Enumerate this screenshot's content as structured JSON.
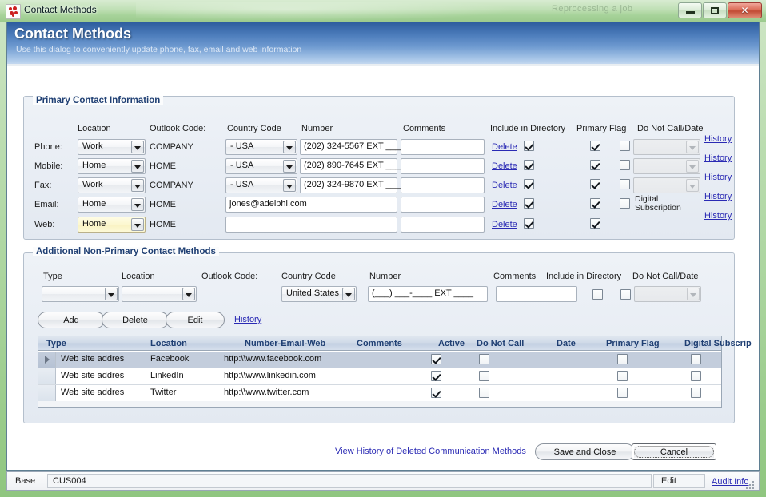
{
  "window": {
    "title": "Contact Methods",
    "icon": "balloons-icon",
    "ghost_text": "Reprocessing a job",
    "controls": {
      "minimize": "minimize-button",
      "maximize": "maximize-button",
      "close": "close-button"
    }
  },
  "banner": {
    "title": "Contact Methods",
    "subtitle": "Use this dialog to conveniently update phone, fax, email and web information"
  },
  "primary_group": {
    "title": "Primary Contact Information",
    "headers": {
      "location": "Location",
      "outlook_code": "Outlook Code:",
      "country_code": "Country Code",
      "number": "Number",
      "comments": "Comments",
      "include_in_directory": "Include in Directory",
      "primary_flag": "Primary Flag",
      "do_not_call": "Do Not Call/Date"
    },
    "rows": [
      {
        "label": "Phone:",
        "location": "Work",
        "outlook_code": "COMPANY",
        "country_code": "- USA",
        "number": "(202) 324-5567 EXT ___",
        "comments": "",
        "delete_label": "Delete",
        "include_in_directory": true,
        "primary_flag": true,
        "do_not_call": false,
        "dnc_note": "",
        "dnc_date": "",
        "dnc_enabled": false,
        "history_label": "History"
      },
      {
        "label": "Mobile:",
        "location": "Home",
        "outlook_code": "HOME",
        "country_code": "- USA",
        "number": "(202) 890-7645 EXT ___",
        "comments": "",
        "delete_label": "Delete",
        "include_in_directory": true,
        "primary_flag": true,
        "do_not_call": false,
        "dnc_note": "",
        "dnc_date": "",
        "dnc_enabled": false,
        "history_label": "History"
      },
      {
        "label": "Fax:",
        "location": "Work",
        "outlook_code": "COMPANY",
        "country_code": "- USA",
        "number": "(202) 324-9870 EXT ___",
        "comments": "",
        "delete_label": "Delete",
        "include_in_directory": true,
        "primary_flag": true,
        "do_not_call": false,
        "dnc_note": "",
        "dnc_date": "",
        "dnc_enabled": false,
        "history_label": "History"
      },
      {
        "label": "Email:",
        "location": "Home",
        "outlook_code": "HOME",
        "country_code": "",
        "number": "jones@adelphi.com",
        "comments": "",
        "delete_label": "Delete",
        "include_in_directory": true,
        "primary_flag": true,
        "do_not_call": false,
        "dnc_note": "Digital Subscription",
        "dnc_date": "",
        "dnc_enabled": false,
        "history_label": "History"
      },
      {
        "label": "Web:",
        "location": "Home",
        "outlook_code": "HOME",
        "country_code": "",
        "number": "",
        "comments": "",
        "delete_label": "Delete",
        "include_in_directory": true,
        "primary_flag": true,
        "do_not_call": null,
        "dnc_note": "",
        "dnc_date": "",
        "dnc_enabled": false,
        "history_label": "History"
      }
    ]
  },
  "additional_group": {
    "title": "Additional Non-Primary Contact Methods",
    "headers": {
      "type": "Type",
      "location": "Location",
      "outlook_code": "Outlook Code:",
      "country_code": "Country Code",
      "number": "Number",
      "comments": "Comments",
      "include_in_directory": "Include in Directory",
      "do_not_call": "Do Not Call/Date"
    },
    "entry": {
      "type": "",
      "location": "",
      "outlook_code": "",
      "country_code": "United States",
      "number": "(___) ___-____ EXT ____",
      "comments": "",
      "include_in_directory": false,
      "do_not_call": false,
      "dnc_date": ""
    },
    "buttons": {
      "add": "Add",
      "delete": "Delete",
      "edit": "Edit",
      "history": "History"
    },
    "grid": {
      "columns": [
        "Type",
        "Location",
        "Number-Email-Web",
        "Comments",
        "Active",
        "Do Not Call",
        "Date",
        "Primary Flag",
        "Digital Subscrip"
      ],
      "rows": [
        {
          "selected": true,
          "type": "Web site addres",
          "location": "Facebook",
          "number": "http:\\\\www.facebook.com",
          "comments": "",
          "active": true,
          "do_not_call": false,
          "date": "",
          "primary_flag": false,
          "digital_subscription": false
        },
        {
          "selected": false,
          "type": "Web site addres",
          "location": "LinkedIn",
          "number": "http:\\\\www.linkedin.com",
          "comments": "",
          "active": true,
          "do_not_call": false,
          "date": "",
          "primary_flag": false,
          "digital_subscription": false
        },
        {
          "selected": false,
          "type": "Web site addres",
          "location": "Twitter",
          "number": "http:\\\\www.twitter.com",
          "comments": "",
          "active": true,
          "do_not_call": false,
          "date": "",
          "primary_flag": false,
          "digital_subscription": false
        }
      ]
    }
  },
  "footer": {
    "history_link": "View History of Deleted Communication Methods",
    "save_and_close": "Save and Close",
    "cancel": "Cancel"
  },
  "statusbar": {
    "base_label": "Base",
    "record_value": "CUS004",
    "mode": "Edit",
    "audit_link": "Audit Info"
  },
  "colors": {
    "banner_top": "#2d5d9e",
    "banner_bottom": "#c3d8ef",
    "frame": "#a9d49c",
    "link": "#2a2ab4",
    "group_title": "#1f3f73",
    "grid_header_text": "#1f3f73",
    "selected_row": "#c3cddc",
    "focus_field": "#fcf7cf"
  }
}
